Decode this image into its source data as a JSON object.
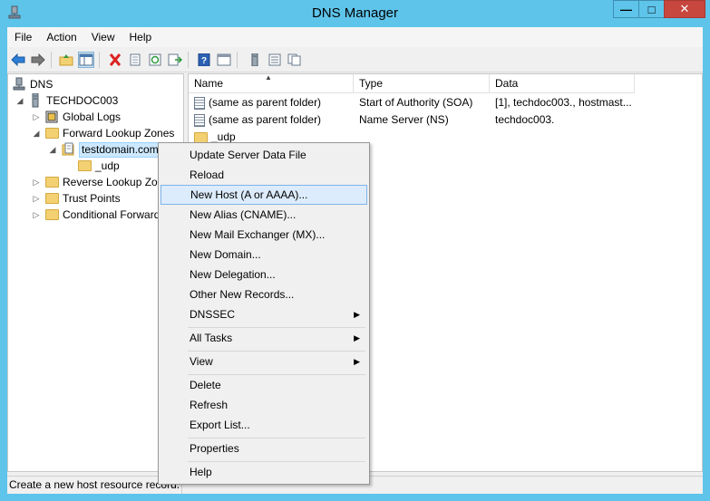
{
  "window": {
    "title": "DNS Manager",
    "min_glyph": "—",
    "max_glyph": "□",
    "close_glyph": "✕"
  },
  "menubar": [
    "File",
    "Action",
    "View",
    "Help"
  ],
  "toolbar_icons": [
    "back-arrow-icon",
    "forward-arrow-icon",
    "up-folder-icon",
    "show-hide-tree-icon",
    "delete-icon",
    "properties-icon",
    "refresh-icon",
    "export-list-icon",
    "help-icon",
    "console-icon",
    "server-icon",
    "list-icon",
    "copy-icon"
  ],
  "tree": {
    "items": [
      {
        "label": "DNS",
        "expander": "",
        "icon": "dns-icon",
        "depth": 0
      },
      {
        "label": "TECHDOC003",
        "expander": "◢",
        "icon": "server-icon",
        "depth": 1
      },
      {
        "label": "Global Logs",
        "expander": "▷",
        "icon": "log-icon",
        "depth": 2
      },
      {
        "label": "Forward Lookup Zones",
        "expander": "◢",
        "icon": "folder-icon",
        "depth": 2
      },
      {
        "label": "testdomain.com",
        "expander": "◢",
        "icon": "zone-icon",
        "depth": 3,
        "selected": true
      },
      {
        "label": "_udp",
        "expander": "",
        "icon": "folder-icon",
        "depth": 4
      },
      {
        "label": "Reverse Lookup Zones",
        "expander": "▷",
        "icon": "folder-icon",
        "depth": 2
      },
      {
        "label": "Trust Points",
        "expander": "▷",
        "icon": "folder-icon",
        "depth": 2
      },
      {
        "label": "Conditional Forwarders",
        "expander": "▷",
        "icon": "folder-icon",
        "depth": 2
      }
    ]
  },
  "list": {
    "columns": [
      "Name",
      "Type",
      "Data"
    ],
    "sort_glyph": "▲",
    "rows": [
      {
        "name": "(same as parent folder)",
        "type": "Start of Authority (SOA)",
        "data": "[1], techdoc003., hostmast...",
        "icon": "record-icon"
      },
      {
        "name": "(same as parent folder)",
        "type": "Name Server (NS)",
        "data": "techdoc003.",
        "icon": "record-icon"
      },
      {
        "name": "_udp",
        "type": "",
        "data": "",
        "icon": "folder-icon"
      }
    ]
  },
  "context_menu": {
    "items": [
      {
        "label": "Update Server Data File"
      },
      {
        "label": "Reload"
      },
      {
        "label": "New Host (A or AAAA)...",
        "highlighted": true
      },
      {
        "label": "New Alias (CNAME)..."
      },
      {
        "label": "New Mail Exchanger (MX)..."
      },
      {
        "label": "New Domain..."
      },
      {
        "label": "New Delegation..."
      },
      {
        "label": "Other New Records..."
      },
      {
        "label": "DNSSEC",
        "submenu": true
      },
      {
        "label": "All Tasks",
        "submenu": true
      },
      {
        "label": "View",
        "submenu": true
      },
      {
        "label": "Delete"
      },
      {
        "label": "Refresh"
      },
      {
        "label": "Export List..."
      },
      {
        "label": "Properties"
      },
      {
        "label": "Help"
      }
    ],
    "submenu_glyph": "▶"
  },
  "status": {
    "text": "Create a new host resource record."
  }
}
